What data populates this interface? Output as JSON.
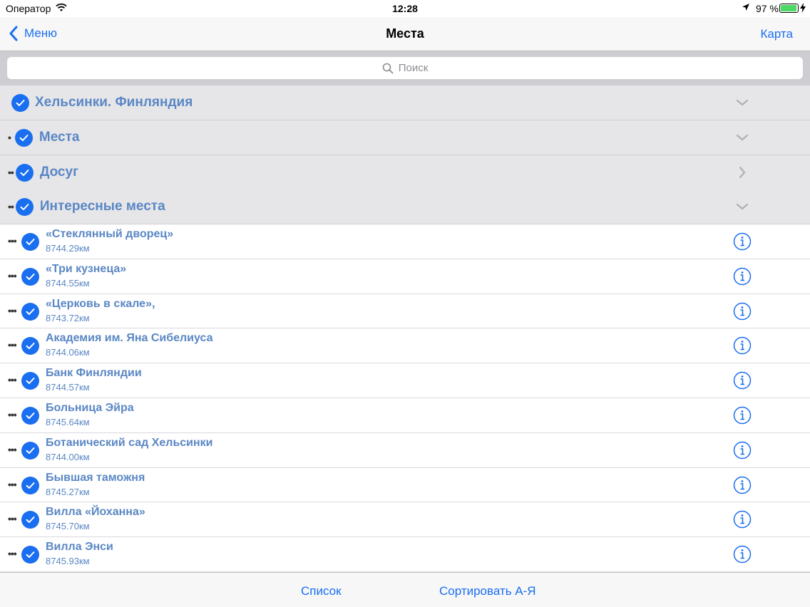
{
  "status_bar": {
    "carrier": "Оператор",
    "time": "12:28",
    "battery_percent": "97 %",
    "battery_level": 0.97,
    "battery_color": "#4cd964",
    "icons": [
      "wifi-icon",
      "location-arrow-icon",
      "charging-bolt-icon"
    ]
  },
  "nav": {
    "back_label": "Меню",
    "title": "Места",
    "right_label": "Карта"
  },
  "search": {
    "placeholder": "Поиск"
  },
  "groups": [
    {
      "label": "Хельсинки. Финляндия",
      "dots": "",
      "chevron": "down"
    },
    {
      "label": "Места",
      "dots": "•",
      "chevron": "down"
    },
    {
      "label": "Досуг",
      "dots": "••",
      "chevron": "right"
    },
    {
      "label": "Интересные места",
      "dots": "••",
      "chevron": "down"
    }
  ],
  "places": [
    {
      "name": "«Стеклянный дворец»",
      "distance": "8744.29км"
    },
    {
      "name": "«Три кузнеца»",
      "distance": "8744.55км"
    },
    {
      "name": "«Церковь в скале»,",
      "distance": "8743.72км"
    },
    {
      "name": "Академия им. Яна Сибелиуса",
      "distance": "8744.06км"
    },
    {
      "name": "Банк Финляндии",
      "distance": "8744.57км"
    },
    {
      "name": "Больница Эйра",
      "distance": "8745.64км"
    },
    {
      "name": "Ботанический сад Хельсинки",
      "distance": "8744.00км"
    },
    {
      "name": "Бывшая таможня",
      "distance": "8745.27км"
    },
    {
      "name": "Вилла «Йоханна»",
      "distance": "8745.70км"
    },
    {
      "name": "Вилла Энси",
      "distance": "8745.93км"
    }
  ],
  "row_dots": "•••",
  "toolbar": {
    "list_label": "Список",
    "sort_label": "Сортировать А-Я"
  },
  "colors": {
    "accent": "#1a6ef0",
    "label_blue": "#5a87c4",
    "group_bg": "#e6e6e9"
  }
}
